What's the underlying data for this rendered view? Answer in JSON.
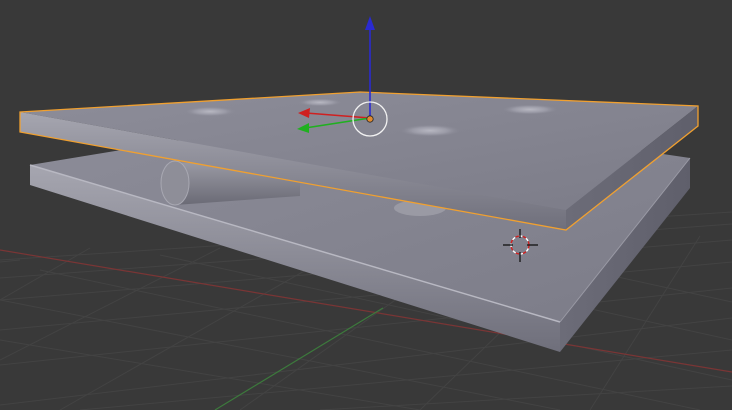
{
  "viewport": {
    "background": "#393939",
    "grid_color": "#424242",
    "x_axis_color": "#8a3b3b",
    "y_axis_color": "#3f7a3f"
  },
  "scene": {
    "objects": [
      {
        "name": "top-plate",
        "selected": true,
        "mesh_color": "#8a8a97",
        "outline_color": "#f0a030"
      },
      {
        "name": "bottom-plate",
        "selected": false,
        "mesh_color": "#85858f"
      },
      {
        "name": "pin-cylinder",
        "selected": false,
        "mesh_color": "#80808a"
      }
    ]
  },
  "gizmo": {
    "type": "translate",
    "x_color": "#d02020",
    "y_color": "#20b020",
    "z_color": "#2a2ad0",
    "pivot_color": "#e08a30"
  },
  "cursor_3d": {
    "icon": "crosshair-icon",
    "ring_colors": [
      "#d02020",
      "#ffffff"
    ]
  }
}
